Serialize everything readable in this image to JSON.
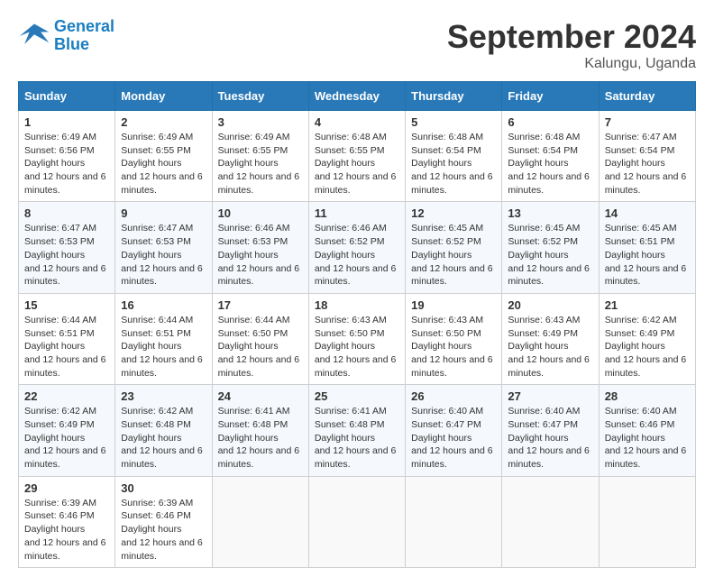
{
  "header": {
    "logo_line1": "General",
    "logo_line2": "Blue",
    "month": "September 2024",
    "location": "Kalungu, Uganda"
  },
  "weekdays": [
    "Sunday",
    "Monday",
    "Tuesday",
    "Wednesday",
    "Thursday",
    "Friday",
    "Saturday"
  ],
  "weeks": [
    [
      {
        "day": 1,
        "sunrise": "6:49 AM",
        "sunset": "6:56 PM",
        "daylight": "12 hours and 6 minutes."
      },
      {
        "day": 2,
        "sunrise": "6:49 AM",
        "sunset": "6:55 PM",
        "daylight": "12 hours and 6 minutes."
      },
      {
        "day": 3,
        "sunrise": "6:49 AM",
        "sunset": "6:55 PM",
        "daylight": "12 hours and 6 minutes."
      },
      {
        "day": 4,
        "sunrise": "6:48 AM",
        "sunset": "6:55 PM",
        "daylight": "12 hours and 6 minutes."
      },
      {
        "day": 5,
        "sunrise": "6:48 AM",
        "sunset": "6:54 PM",
        "daylight": "12 hours and 6 minutes."
      },
      {
        "day": 6,
        "sunrise": "6:48 AM",
        "sunset": "6:54 PM",
        "daylight": "12 hours and 6 minutes."
      },
      {
        "day": 7,
        "sunrise": "6:47 AM",
        "sunset": "6:54 PM",
        "daylight": "12 hours and 6 minutes."
      }
    ],
    [
      {
        "day": 8,
        "sunrise": "6:47 AM",
        "sunset": "6:53 PM",
        "daylight": "12 hours and 6 minutes."
      },
      {
        "day": 9,
        "sunrise": "6:47 AM",
        "sunset": "6:53 PM",
        "daylight": "12 hours and 6 minutes."
      },
      {
        "day": 10,
        "sunrise": "6:46 AM",
        "sunset": "6:53 PM",
        "daylight": "12 hours and 6 minutes."
      },
      {
        "day": 11,
        "sunrise": "6:46 AM",
        "sunset": "6:52 PM",
        "daylight": "12 hours and 6 minutes."
      },
      {
        "day": 12,
        "sunrise": "6:45 AM",
        "sunset": "6:52 PM",
        "daylight": "12 hours and 6 minutes."
      },
      {
        "day": 13,
        "sunrise": "6:45 AM",
        "sunset": "6:52 PM",
        "daylight": "12 hours and 6 minutes."
      },
      {
        "day": 14,
        "sunrise": "6:45 AM",
        "sunset": "6:51 PM",
        "daylight": "12 hours and 6 minutes."
      }
    ],
    [
      {
        "day": 15,
        "sunrise": "6:44 AM",
        "sunset": "6:51 PM",
        "daylight": "12 hours and 6 minutes."
      },
      {
        "day": 16,
        "sunrise": "6:44 AM",
        "sunset": "6:51 PM",
        "daylight": "12 hours and 6 minutes."
      },
      {
        "day": 17,
        "sunrise": "6:44 AM",
        "sunset": "6:50 PM",
        "daylight": "12 hours and 6 minutes."
      },
      {
        "day": 18,
        "sunrise": "6:43 AM",
        "sunset": "6:50 PM",
        "daylight": "12 hours and 6 minutes."
      },
      {
        "day": 19,
        "sunrise": "6:43 AM",
        "sunset": "6:50 PM",
        "daylight": "12 hours and 6 minutes."
      },
      {
        "day": 20,
        "sunrise": "6:43 AM",
        "sunset": "6:49 PM",
        "daylight": "12 hours and 6 minutes."
      },
      {
        "day": 21,
        "sunrise": "6:42 AM",
        "sunset": "6:49 PM",
        "daylight": "12 hours and 6 minutes."
      }
    ],
    [
      {
        "day": 22,
        "sunrise": "6:42 AM",
        "sunset": "6:49 PM",
        "daylight": "12 hours and 6 minutes."
      },
      {
        "day": 23,
        "sunrise": "6:42 AM",
        "sunset": "6:48 PM",
        "daylight": "12 hours and 6 minutes."
      },
      {
        "day": 24,
        "sunrise": "6:41 AM",
        "sunset": "6:48 PM",
        "daylight": "12 hours and 6 minutes."
      },
      {
        "day": 25,
        "sunrise": "6:41 AM",
        "sunset": "6:48 PM",
        "daylight": "12 hours and 6 minutes."
      },
      {
        "day": 26,
        "sunrise": "6:40 AM",
        "sunset": "6:47 PM",
        "daylight": "12 hours and 6 minutes."
      },
      {
        "day": 27,
        "sunrise": "6:40 AM",
        "sunset": "6:47 PM",
        "daylight": "12 hours and 6 minutes."
      },
      {
        "day": 28,
        "sunrise": "6:40 AM",
        "sunset": "6:46 PM",
        "daylight": "12 hours and 6 minutes."
      }
    ],
    [
      {
        "day": 29,
        "sunrise": "6:39 AM",
        "sunset": "6:46 PM",
        "daylight": "12 hours and 6 minutes."
      },
      {
        "day": 30,
        "sunrise": "6:39 AM",
        "sunset": "6:46 PM",
        "daylight": "12 hours and 6 minutes."
      },
      null,
      null,
      null,
      null,
      null
    ]
  ]
}
